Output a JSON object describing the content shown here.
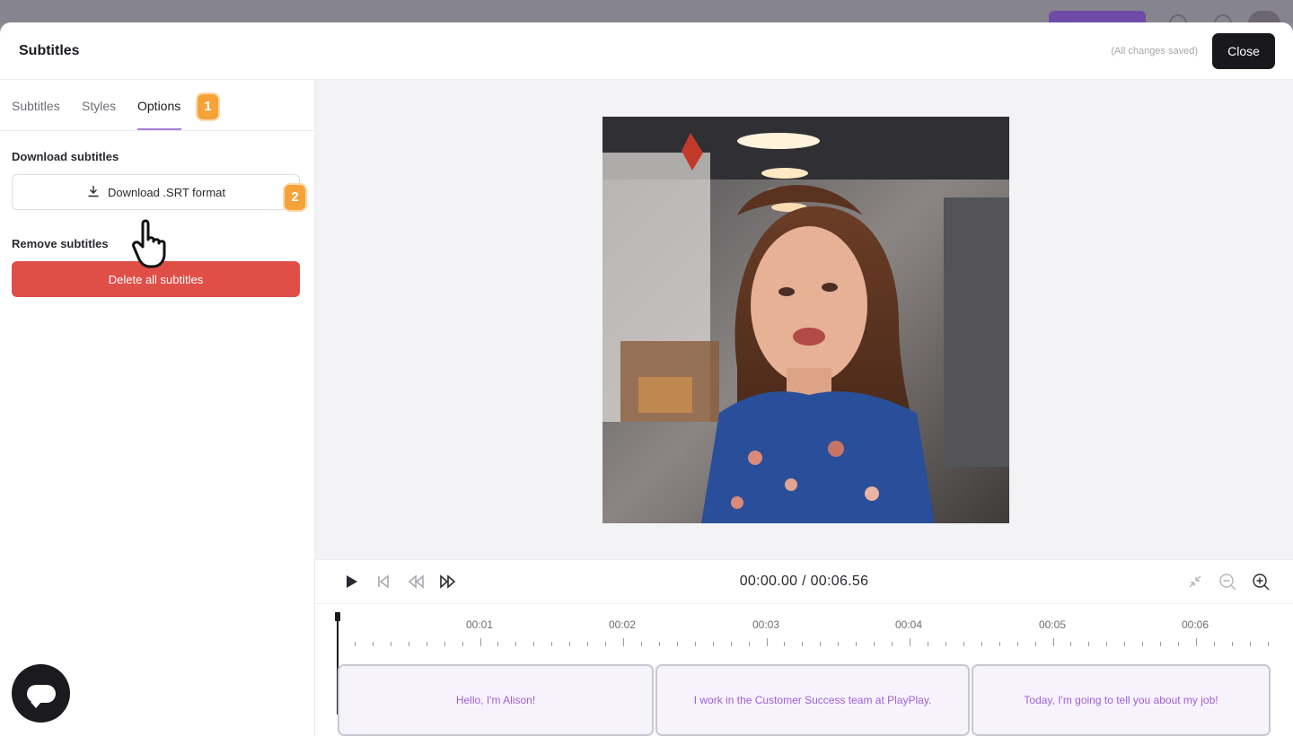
{
  "modal": {
    "title": "Subtitles",
    "save_status": "(All changes saved)",
    "close_label": "Close"
  },
  "tabs": [
    {
      "label": "Subtitles"
    },
    {
      "label": "Styles"
    },
    {
      "label": "Options",
      "active": true
    }
  ],
  "badges": [
    "1",
    "2"
  ],
  "options": {
    "download_heading": "Download subtitles",
    "download_button": "Download .SRT format",
    "remove_heading": "Remove subtitles",
    "delete_button": "Delete all subtitles"
  },
  "player": {
    "time_display": "00:00.00 / 00:06.56"
  },
  "timeline": {
    "ticks": [
      "00:01",
      "00:02",
      "00:03",
      "00:04",
      "00:05",
      "00:06"
    ],
    "clips": [
      {
        "text": "Hello, I'm Alison!"
      },
      {
        "text": "I work in the Customer Success team at PlayPlay."
      },
      {
        "text": "Today, I'm going to tell you about my job!"
      }
    ]
  },
  "colors": {
    "accent": "#a779d8",
    "badge": "#f5a23a",
    "danger": "#e04e48",
    "clip_text": "#a05fd6"
  }
}
